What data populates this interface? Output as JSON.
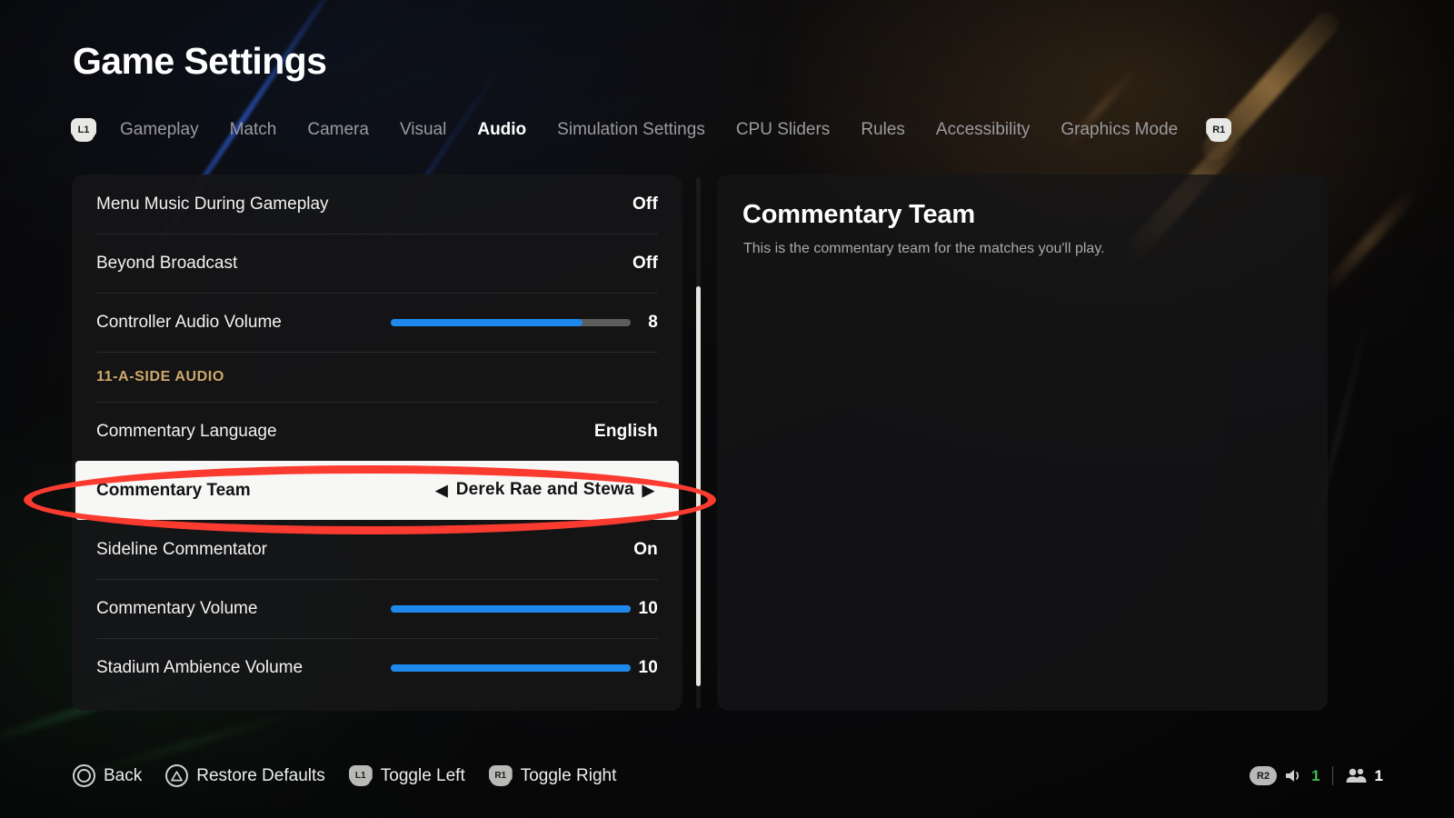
{
  "header": {
    "title": "Game Settings"
  },
  "tabs": {
    "left_bumper": "L1",
    "right_bumper": "R1",
    "items": [
      {
        "label": "Gameplay",
        "active": false
      },
      {
        "label": "Match",
        "active": false
      },
      {
        "label": "Camera",
        "active": false
      },
      {
        "label": "Visual",
        "active": false
      },
      {
        "label": "Audio",
        "active": true
      },
      {
        "label": "Simulation Settings",
        "active": false
      },
      {
        "label": "CPU Sliders",
        "active": false
      },
      {
        "label": "Rules",
        "active": false
      },
      {
        "label": "Accessibility",
        "active": false
      },
      {
        "label": "Graphics Mode",
        "active": false
      }
    ]
  },
  "settings_list": {
    "rows": [
      {
        "type": "toggle",
        "label": "Menu Music During Gameplay",
        "value": "Off"
      },
      {
        "type": "toggle",
        "label": "Beyond Broadcast",
        "value": "Off"
      },
      {
        "type": "slider",
        "label": "Controller Audio Volume",
        "value": "8",
        "fill_percent": 80
      },
      {
        "type": "section",
        "label": "11-A-SIDE AUDIO"
      },
      {
        "type": "toggle",
        "label": "Commentary Language",
        "value": "English"
      },
      {
        "type": "selector",
        "label": "Commentary Team",
        "value": "Derek Rae and Stewa",
        "selected": true,
        "arrow_left": "◀",
        "arrow_right": "▶"
      },
      {
        "type": "toggle",
        "label": "Sideline Commentator",
        "value": "On"
      },
      {
        "type": "slider",
        "label": "Commentary Volume",
        "value": "10",
        "fill_percent": 100
      },
      {
        "type": "slider",
        "label": "Stadium Ambience Volume",
        "value": "10",
        "fill_percent": 100
      }
    ]
  },
  "detail": {
    "title": "Commentary Team",
    "description": "This is the commentary team for the matches you'll play."
  },
  "bottom_bar": {
    "hints": [
      {
        "glyph": "circle",
        "label": "Back"
      },
      {
        "glyph": "triangle",
        "label": "Restore Defaults"
      },
      {
        "glyph": "L1",
        "label": "Toggle Left"
      },
      {
        "glyph": "R1",
        "label": "Toggle Right"
      }
    ]
  },
  "status": {
    "bumper": "R2",
    "volume_count": "1",
    "players_count": "1"
  },
  "colors": {
    "accent_blue": "#1e88ec",
    "section_gold": "#cfa86a",
    "annotation_red": "#fb3b30",
    "status_green": "#3fbf52",
    "selected_bg": "#f7f7f5"
  }
}
